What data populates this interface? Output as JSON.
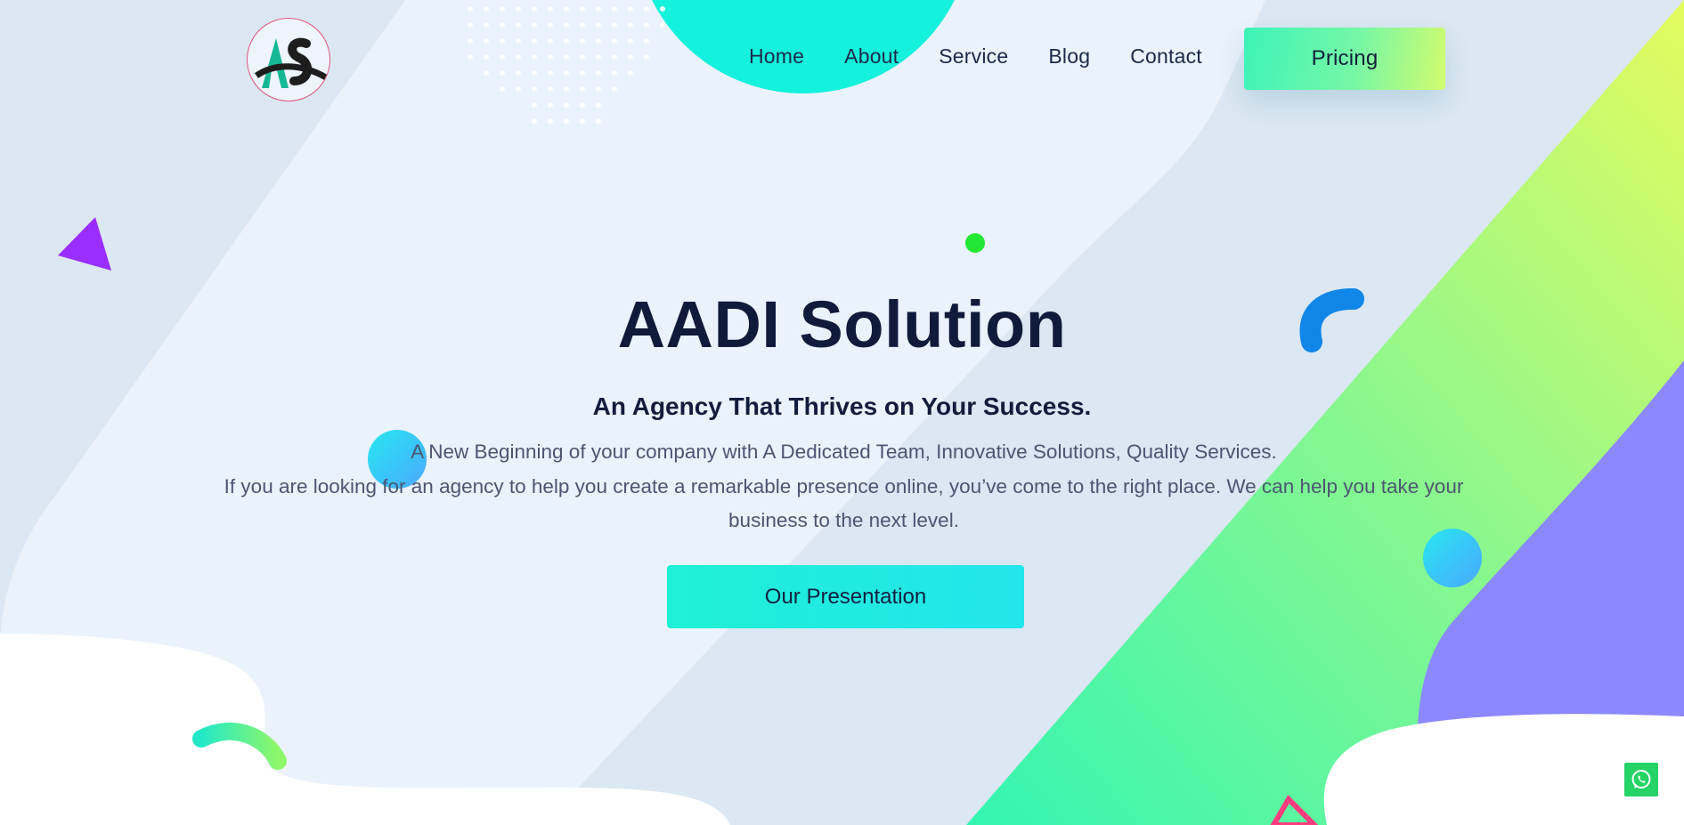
{
  "brand": {
    "logo_alt": "AS logo",
    "logo_text": "AS"
  },
  "nav": {
    "items": [
      {
        "label": "Home"
      },
      {
        "label": "About"
      },
      {
        "label": "Service"
      },
      {
        "label": "Blog"
      },
      {
        "label": "Contact"
      }
    ],
    "cta_label": "Pricing"
  },
  "hero": {
    "title": "AADI Solution",
    "subtitle": "An Agency That Thrives on Your Success.",
    "line1": "A New Beginning of your company with A Dedicated Team, Innovative Solutions, Quality Services.",
    "line2": "If you are looking for an agency to help you create a remarkable presence online, you’ve come to the right place. We can help you take your business to the next level.",
    "button_label": "Our Presentation"
  },
  "floating": {
    "whatsapp_icon": "whatsapp-icon"
  },
  "colors": {
    "accent_cyan": "#1ff0d6",
    "accent_green": "#75f7a6",
    "accent_lime": "#d2fb6e",
    "accent_purple": "#8b87ff",
    "heading": "#101a3a"
  }
}
